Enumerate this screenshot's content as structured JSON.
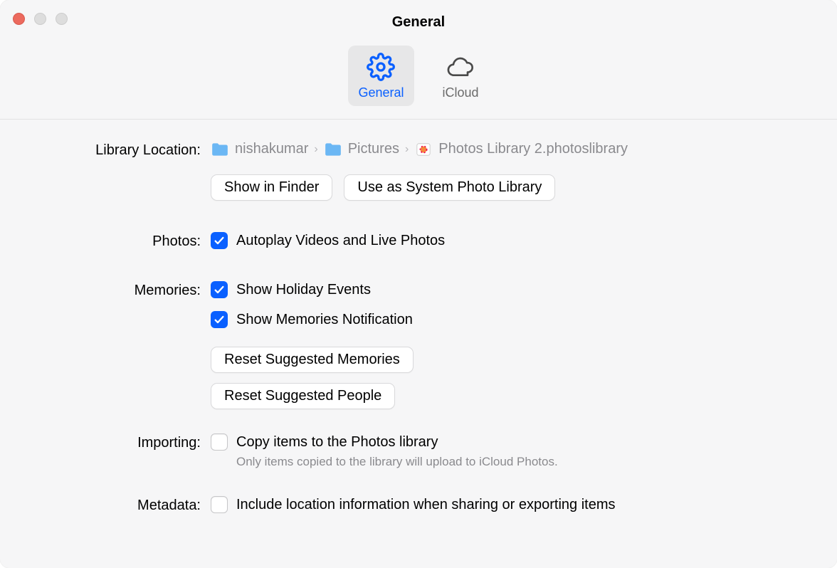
{
  "window": {
    "title": "General"
  },
  "tabs": {
    "general": "General",
    "icloud": "iCloud"
  },
  "labels": {
    "library_location": "Library Location:",
    "photos": "Photos:",
    "memories": "Memories:",
    "importing": "Importing:",
    "metadata": "Metadata:"
  },
  "breadcrumb": {
    "part1": "nishakumar",
    "part2": "Pictures",
    "part3": "Photos Library 2.photoslibrary"
  },
  "buttons": {
    "show_in_finder": "Show in Finder",
    "use_system_library": "Use as System Photo Library",
    "reset_memories": "Reset Suggested Memories",
    "reset_people": "Reset Suggested People"
  },
  "checks": {
    "autoplay": "Autoplay Videos and Live Photos",
    "holiday": "Show Holiday Events",
    "memories_notif": "Show Memories Notification",
    "copy_items": "Copy items to the Photos library",
    "copy_items_sub": "Only items copied to the library will upload to iCloud Photos.",
    "location": "Include location information when sharing or exporting items"
  }
}
